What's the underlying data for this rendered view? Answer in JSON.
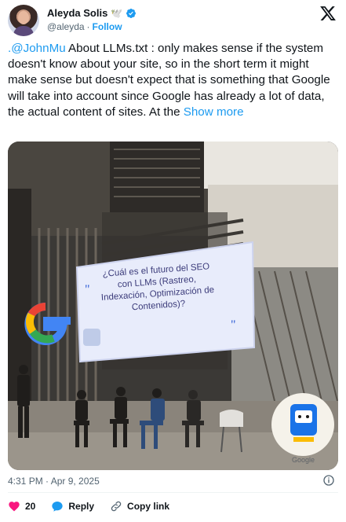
{
  "author": {
    "display_name": "Aleyda Solis",
    "emoji": "🕊️",
    "handle": "@aleyda",
    "separator": "·",
    "follow_label": "Follow"
  },
  "tweet": {
    "mention": ".@JohnMu",
    "body": " About LLMs.txt : only makes sense if the system doesn't know about your site, so in the short term it might make sense but doesn't expect that is something that Google will take into account since Google has already a lot of data, the actual content of sites. At the ",
    "show_more": "Show more"
  },
  "photo": {
    "slide_lines": [
      "¿Cuál es el futuro del SEO",
      "con LLMs (Rastreo,",
      "Indexación, Optimización de",
      "Contenidos)?"
    ],
    "google_badge_label": "Google"
  },
  "meta": {
    "timestamp": "4:31 PM · Apr 9, 2025"
  },
  "actions": {
    "like_count": "20",
    "reply_label": "Reply",
    "copy_label": "Copy link"
  },
  "colors": {
    "accent": "#1d9bf0",
    "like": "#f91880",
    "text": "#0f1419",
    "muted": "#536471"
  }
}
